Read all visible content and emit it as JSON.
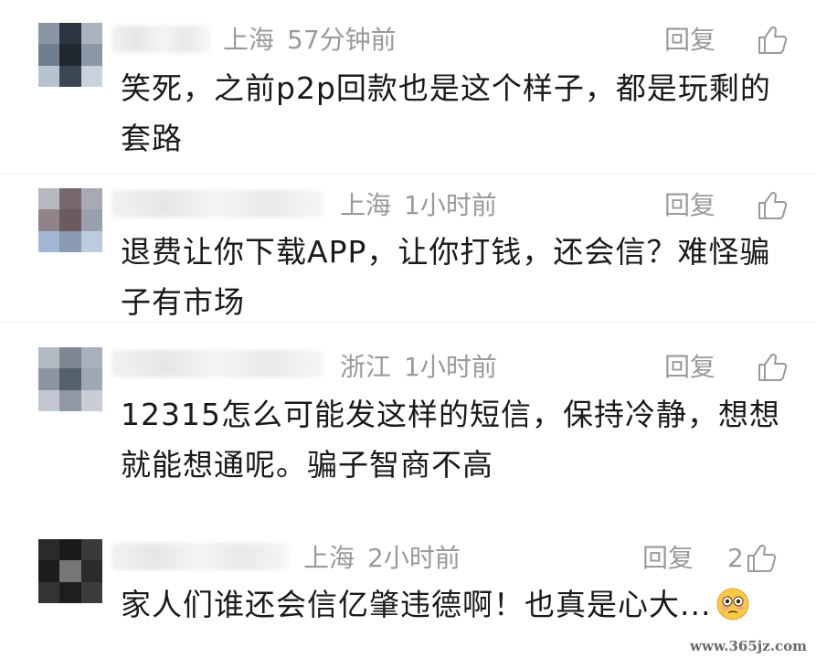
{
  "comments": [
    {
      "location": "上海",
      "time": "57分钟前",
      "reply_label": "回复",
      "likes": "",
      "text": "笑死，之前p2p回款也是这个样子，都是玩剩的套路"
    },
    {
      "location": "上海",
      "time": "1小时前",
      "reply_label": "回复",
      "likes": "",
      "text": "退费让你下载APP，让你打钱，还会信？难怪骗子有市场"
    },
    {
      "location": "浙江",
      "time": "1小时前",
      "reply_label": "回复",
      "likes": "",
      "text": "12315怎么可能发这样的短信，保持冷静，想想就能想通呢。骗子智商不高"
    },
    {
      "location": "上海",
      "time": "2小时前",
      "reply_label": "回复",
      "likes": "2",
      "text": "家人们谁还会信亿肇违德啊！也真是心大..."
    }
  ],
  "icons": {
    "like": "thumbs-up-icon",
    "emoji": "flushed-face-emoji"
  },
  "watermark": "www.365jz.com"
}
